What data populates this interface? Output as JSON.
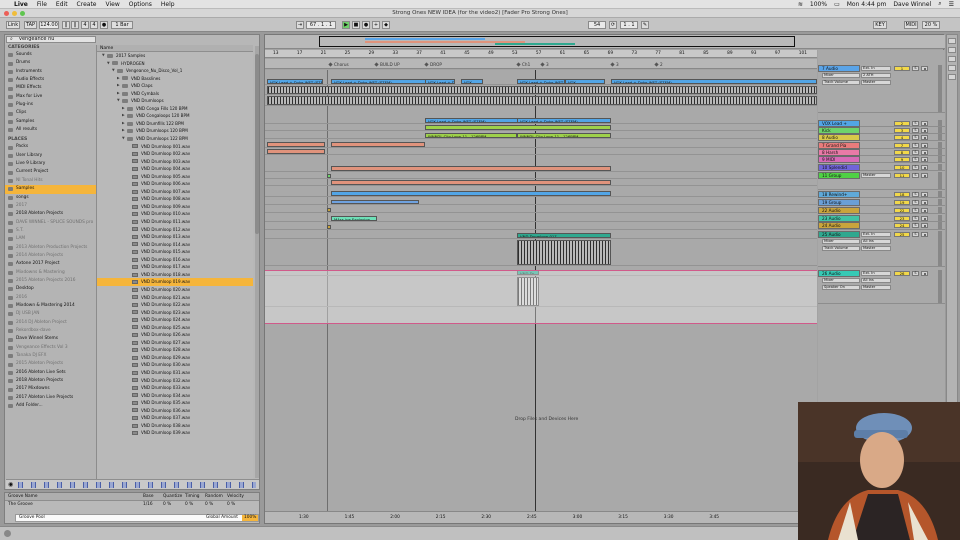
{
  "menubar": {
    "app": "Live",
    "items": [
      "File",
      "Edit",
      "Create",
      "View",
      "Options",
      "Help"
    ],
    "battery": "100%",
    "clock": "Mon 4:44 pm",
    "user": "Dave Winnel"
  },
  "window": {
    "title": "Strong Ones NEW IDEA (for the video2)  [Fader Pro Strong Ones]"
  },
  "transport": {
    "link": "Link",
    "tap": "TAP",
    "tempo": "124.00",
    "meter_num": "4",
    "meter_den": "4",
    "quantize": "1 Bar",
    "arr_position": "67 . 1 . 1",
    "loop_start": "54",
    "loop_length": "1 . 1",
    "key": "KEY",
    "midi": "MIDI",
    "cpu": "20 %"
  },
  "browser": {
    "search_value": "vengeance nu",
    "categories_header": "CATEGORIES",
    "categories": [
      {
        "label": "Sounds",
        "dim": false,
        "sel": false
      },
      {
        "label": "Drums",
        "dim": false,
        "sel": false
      },
      {
        "label": "Instruments",
        "dim": false,
        "sel": false
      },
      {
        "label": "Audio Effects",
        "dim": false,
        "sel": false
      },
      {
        "label": "MIDI Effects",
        "dim": false,
        "sel": false
      },
      {
        "label": "Max for Live",
        "dim": false,
        "sel": false
      },
      {
        "label": "Plug-ins",
        "dim": false,
        "sel": false
      },
      {
        "label": "Clips",
        "dim": false,
        "sel": false
      },
      {
        "label": "Samples",
        "dim": false,
        "sel": false
      },
      {
        "label": "All results",
        "dim": false,
        "sel": false
      }
    ],
    "places_header": "PLACES",
    "places": [
      {
        "label": "Packs",
        "dim": false,
        "sel": false
      },
      {
        "label": "User Library",
        "dim": false,
        "sel": false
      },
      {
        "label": "Live 9 Library",
        "dim": false,
        "sel": false
      },
      {
        "label": "Current Project",
        "dim": false,
        "sel": false
      },
      {
        "label": "NI Tonal Hits",
        "dim": true,
        "sel": false
      },
      {
        "label": "Samples",
        "dim": false,
        "sel": true
      },
      {
        "label": "songs",
        "dim": false,
        "sel": false
      },
      {
        "label": "2017",
        "dim": true,
        "sel": false
      },
      {
        "label": "2018 Ableton Projects",
        "dim": false,
        "sel": false
      },
      {
        "label": "DAVE WINNEL - SPLICE SOUNDS pro",
        "dim": true,
        "sel": false
      },
      {
        "label": "S.T.",
        "dim": true,
        "sel": false
      },
      {
        "label": "LAM",
        "dim": true,
        "sel": false
      },
      {
        "label": "2013 Ableton Production Projects",
        "dim": true,
        "sel": false
      },
      {
        "label": "2014 Ableton Projects",
        "dim": true,
        "sel": false
      },
      {
        "label": "Axtone 2017 Project",
        "dim": false,
        "sel": false
      },
      {
        "label": "Mixdowns & Mastering",
        "dim": true,
        "sel": false
      },
      {
        "label": "2015 Ableton Projects 2016",
        "dim": true,
        "sel": false
      },
      {
        "label": "Desktop",
        "dim": false,
        "sel": false
      },
      {
        "label": "2016",
        "dim": true,
        "sel": false
      },
      {
        "label": "Mixdown & Mastering 2014",
        "dim": false,
        "sel": false
      },
      {
        "label": "DJ USB JAN",
        "dim": true,
        "sel": false
      },
      {
        "label": "2014 DJ Ableton Project",
        "dim": true,
        "sel": false
      },
      {
        "label": "Rekordbox-dave",
        "dim": true,
        "sel": false
      },
      {
        "label": "Dave Winnel Stems",
        "dim": false,
        "sel": false
      },
      {
        "label": "Vengeance Effects Vol 3",
        "dim": true,
        "sel": false
      },
      {
        "label": "Tanaka DJ EFX",
        "dim": true,
        "sel": false
      },
      {
        "label": "2015 Ableton Projects",
        "dim": true,
        "sel": false
      },
      {
        "label": "2016 Ableton Live Sets",
        "dim": false,
        "sel": false
      },
      {
        "label": "2018 Ableton Projects",
        "dim": false,
        "sel": false
      },
      {
        "label": "2017 Mixdowns",
        "dim": false,
        "sel": false
      },
      {
        "label": "2017 Ableton Live Projects",
        "dim": false,
        "sel": false
      },
      {
        "label": "Add Folder...",
        "dim": false,
        "sel": false
      }
    ],
    "name_header": "Name",
    "files": [
      {
        "label": "2017 Samples",
        "indent": 1,
        "type": "folder",
        "arrow": "▼"
      },
      {
        "label": "HYDROGEN",
        "indent": 2,
        "type": "folder",
        "arrow": "▼"
      },
      {
        "label": "Vengeance_Nu_Disco_Vol_1",
        "indent": 3,
        "type": "folder",
        "arrow": "▼"
      },
      {
        "label": "VND Basslines",
        "indent": 4,
        "type": "folder",
        "arrow": "▶"
      },
      {
        "label": "VND Claps",
        "indent": 4,
        "type": "folder",
        "arrow": "▶"
      },
      {
        "label": "VND Cymbals",
        "indent": 4,
        "type": "folder",
        "arrow": "▶"
      },
      {
        "label": "VND Drumloops",
        "indent": 4,
        "type": "folder",
        "arrow": "▼"
      },
      {
        "label": "VND Conga Fills 120 BPM",
        "indent": 5,
        "type": "folder",
        "arrow": "▶"
      },
      {
        "label": "VND Congaloops 120 BPM",
        "indent": 5,
        "type": "folder",
        "arrow": "▶"
      },
      {
        "label": "VND Drumfills 122 BPM",
        "indent": 5,
        "type": "folder",
        "arrow": "▶"
      },
      {
        "label": "VND Drumloops 120 BPM",
        "indent": 5,
        "type": "folder",
        "arrow": "▶"
      },
      {
        "label": "VND Drumloops 122 BPM",
        "indent": 5,
        "type": "folder",
        "arrow": "▼"
      },
      {
        "label": "VND Drumloop 001.wav",
        "indent": 6,
        "type": "wav"
      },
      {
        "label": "VND Drumloop 002.wav",
        "indent": 6,
        "type": "wav"
      },
      {
        "label": "VND Drumloop 003.wav",
        "indent": 6,
        "type": "wav"
      },
      {
        "label": "VND Drumloop 004.wav",
        "indent": 6,
        "type": "wav"
      },
      {
        "label": "VND Drumloop 005.wav",
        "indent": 6,
        "type": "wav"
      },
      {
        "label": "VND Drumloop 006.wav",
        "indent": 6,
        "type": "wav"
      },
      {
        "label": "VND Drumloop 007.wav",
        "indent": 6,
        "type": "wav"
      },
      {
        "label": "VND Drumloop 008.wav",
        "indent": 6,
        "type": "wav"
      },
      {
        "label": "VND Drumloop 009.wav",
        "indent": 6,
        "type": "wav"
      },
      {
        "label": "VND Drumloop 010.wav",
        "indent": 6,
        "type": "wav"
      },
      {
        "label": "VND Drumloop 011.wav",
        "indent": 6,
        "type": "wav"
      },
      {
        "label": "VND Drumloop 012.wav",
        "indent": 6,
        "type": "wav"
      },
      {
        "label": "VND Drumloop 013.wav",
        "indent": 6,
        "type": "wav"
      },
      {
        "label": "VND Drumloop 014.wav",
        "indent": 6,
        "type": "wav"
      },
      {
        "label": "VND Drumloop 015.wav",
        "indent": 6,
        "type": "wav"
      },
      {
        "label": "VND Drumloop 016.wav",
        "indent": 6,
        "type": "wav"
      },
      {
        "label": "VND Drumloop 017.wav",
        "indent": 6,
        "type": "wav"
      },
      {
        "label": "VND Drumloop 018.wav",
        "indent": 6,
        "type": "wav"
      },
      {
        "label": "VND Drumloop 019.wav",
        "indent": 6,
        "type": "wav",
        "sel": true
      },
      {
        "label": "VND Drumloop 020.wav",
        "indent": 6,
        "type": "wav"
      },
      {
        "label": "VND Drumloop 021.wav",
        "indent": 6,
        "type": "wav"
      },
      {
        "label": "VND Drumloop 022.wav",
        "indent": 6,
        "type": "wav"
      },
      {
        "label": "VND Drumloop 023.wav",
        "indent": 6,
        "type": "wav"
      },
      {
        "label": "VND Drumloop 024.wav",
        "indent": 6,
        "type": "wav"
      },
      {
        "label": "VND Drumloop 025.wav",
        "indent": 6,
        "type": "wav"
      },
      {
        "label": "VND Drumloop 026.wav",
        "indent": 6,
        "type": "wav"
      },
      {
        "label": "VND Drumloop 027.wav",
        "indent": 6,
        "type": "wav"
      },
      {
        "label": "VND Drumloop 028.wav",
        "indent": 6,
        "type": "wav"
      },
      {
        "label": "VND Drumloop 029.wav",
        "indent": 6,
        "type": "wav"
      },
      {
        "label": "VND Drumloop 030.wav",
        "indent": 6,
        "type": "wav"
      },
      {
        "label": "VND Drumloop 031.wav",
        "indent": 6,
        "type": "wav"
      },
      {
        "label": "VND Drumloop 032.wav",
        "indent": 6,
        "type": "wav"
      },
      {
        "label": "VND Drumloop 033.wav",
        "indent": 6,
        "type": "wav"
      },
      {
        "label": "VND Drumloop 034.wav",
        "indent": 6,
        "type": "wav"
      },
      {
        "label": "VND Drumloop 035.wav",
        "indent": 6,
        "type": "wav"
      },
      {
        "label": "VND Drumloop 036.wav",
        "indent": 6,
        "type": "wav"
      },
      {
        "label": "VND Drumloop 037.wav",
        "indent": 6,
        "type": "wav"
      },
      {
        "label": "VND Drumloop 038.wav",
        "indent": 6,
        "type": "wav"
      },
      {
        "label": "VND Drumloop 039.wav",
        "indent": 6,
        "type": "wav"
      }
    ]
  },
  "groove": {
    "headers": [
      "Groove Name",
      "Base",
      "Quantize",
      "Timing",
      "Random",
      "Velocity"
    ],
    "row": [
      "The Groove",
      "1/16",
      "0 %",
      "0 %",
      "0 %",
      "0 %"
    ],
    "pool": "Groove Pool",
    "global_amount_label": "Global Amount",
    "global_amount": "100%"
  },
  "ruler": {
    "bars": [
      "13",
      "17",
      "21",
      "25",
      "29",
      "33",
      "37",
      "41",
      "45",
      "49",
      "53",
      "57",
      "61",
      "65",
      "69",
      "73",
      "77",
      "81",
      "85",
      "89",
      "93",
      "97",
      "101"
    ],
    "set_label": "Set"
  },
  "locators": [
    "Chorus",
    "BUILD UP",
    "DROP",
    "Ch1",
    "3",
    "3",
    "2"
  ],
  "time_axis": [
    "1:30",
    "1:45",
    "2:00",
    "2:15",
    "2:30",
    "2:45",
    "3:00",
    "3:15",
    "3:30",
    "3:45"
  ],
  "drop_hint": "Drop Files and Devices Here",
  "clip_labels": {
    "vox_a": "VOX Lead + Dubs WET (STEM)",
    "vox_short": "VOX",
    "vox_lead": "VOX Lead",
    "wnndl": "WNNDL Clip Loop 11 - 126BPM",
    "fx": "MAss ive Explosion",
    "drumloop": "VND Drumloop 017",
    "vnd_short": "VND Dr"
  },
  "tracks": [
    {
      "name": "7 Audio",
      "color": "#5aa4e8",
      "io": "Ext. In",
      "num": "1",
      "sub": "Mixer",
      "sub2": "Track Volume",
      "io2": "2 ATH",
      "numColor": "#f2d84a"
    },
    {
      "name": "VOX Lead +",
      "color": "#52a5e6",
      "io": "",
      "num": "2",
      "sub": "",
      "sub2": "",
      "io2": "",
      "numColor": "#f2d84a"
    },
    {
      "name": "Kick",
      "color": "#6ed36c",
      "io": "",
      "num": "3",
      "sub": "",
      "sub2": "",
      "io2": "",
      "numColor": "#f2d84a"
    },
    {
      "name": "8 Audio",
      "color": "#d8c84a",
      "io": "",
      "num": "4",
      "sub": "",
      "sub2": "",
      "io2": "",
      "numColor": "#f2d84a"
    },
    {
      "name": "7 Grand Pia",
      "color": "#e87c7c",
      "io": "",
      "num": "7",
      "sub": "",
      "sub2": "",
      "io2": "",
      "numColor": "#f2d84a"
    },
    {
      "name": "8 Harsh",
      "color": "#e97aa7",
      "io": "",
      "num": "8",
      "sub": "",
      "sub2": "",
      "io2": "",
      "numColor": "#f2d84a"
    },
    {
      "name": "9 MIDI",
      "color": "#d86bb7",
      "io": "",
      "num": "9",
      "sub": "",
      "sub2": "",
      "io2": "",
      "numColor": "#f2d84a"
    },
    {
      "name": "10 Splendid",
      "color": "#7064d8",
      "io": "",
      "num": "10",
      "sub": "",
      "sub2": "",
      "io2": "",
      "numColor": "#f2d84a"
    },
    {
      "name": "11 Group",
      "color": "#4fd145",
      "io": "Master",
      "num": "11",
      "sub": "",
      "sub2": "",
      "io2": "",
      "numColor": "#f2d84a"
    },
    {
      "name": "18 Rewind+",
      "color": "#5fa9d8",
      "io": "",
      "num": "18",
      "sub": "",
      "sub2": "",
      "io2": "",
      "numColor": "#f2d84a"
    },
    {
      "name": "19 Group",
      "color": "#6a9fd6",
      "io": "",
      "num": "19",
      "sub": "",
      "sub2": "",
      "io2": "",
      "numColor": "#f2d84a"
    },
    {
      "name": "22 Audio",
      "color": "#c9a43d",
      "io": "",
      "num": "22",
      "sub": "",
      "sub2": "",
      "io2": "",
      "numColor": "#f2d84a"
    },
    {
      "name": "23 Audio",
      "color": "#41c3a6",
      "io": "",
      "num": "23",
      "sub": "",
      "sub2": "",
      "io2": "",
      "numColor": "#f2d84a"
    },
    {
      "name": "24 Audio",
      "color": "#c9a43d",
      "io": "",
      "num": "24",
      "sub": "",
      "sub2": "",
      "io2": "",
      "numColor": "#f2d84a"
    },
    {
      "name": "25 Audio",
      "color": "#2fa88f",
      "io": "Ext. In",
      "num": "25",
      "sub": "Mixer",
      "sub2": "Track Volume",
      "io2": "All Ins",
      "numColor": "#f2d84a"
    },
    {
      "name": "26 Audio",
      "color": "#36c9b5",
      "io": "Ext. In",
      "num": "26",
      "sub": "Mixer",
      "sub2": "Speaker On",
      "io2": "All Ins",
      "numColor": "#f2d84a"
    }
  ],
  "master_label": "Master",
  "colors": {
    "selection": "#f5b53b",
    "blue_clip": "#52a5e6",
    "salmon_clip": "#e0937c",
    "green_clip": "#9ed14a",
    "teal_clip": "#2fa88f"
  }
}
